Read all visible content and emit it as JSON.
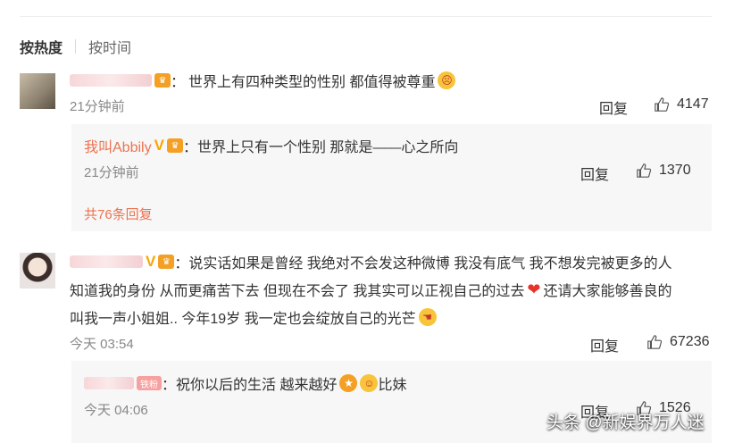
{
  "sort": {
    "hot": "按热度",
    "time": "按时间"
  },
  "comments": [
    {
      "text_prefix": "：",
      "text": "世界上有四种类型的性别 都值得被尊重",
      "time": "21分钟前",
      "reply_label": "回复",
      "likes": "4147",
      "replies": [
        {
          "username": "我叫Abbily",
          "text": "：世界上只有一个性别 那就是——心之所向",
          "time": "21分钟前",
          "reply_label": "回复",
          "likes": "1370"
        }
      ],
      "more_replies": "共76条回复"
    },
    {
      "text_line1": "：说实话如果是曾经 我绝对不会发这种微博 我没有底气 我不想发完被更多的人",
      "text_line2_a": "知道我的身份 从而更痛苦下去 但现在不会了 我其实可以正视自己的过去",
      "text_line2_b": "还请大家能够善良的",
      "text_line3": "叫我一声小姐姐.. 今年19岁 我一定也会绽放自己的光芒",
      "time": "今天 03:54",
      "reply_label": "回复",
      "likes": "67236",
      "replies": [
        {
          "badge": "铁粉",
          "text_a": "：祝你以后的生活 越来越好",
          "text_b": "比妹",
          "time": "今天 04:06",
          "reply_label": "回复",
          "likes": "1526"
        }
      ]
    }
  ],
  "watermark": "头条 @新娱界万人迷",
  "colors": {
    "accent": "#eb7350",
    "vip": "#f7a600",
    "heart": "#e8322c"
  },
  "icons": [
    "crown-badge-icon",
    "v-badge-icon",
    "surprised-emoji-icon",
    "heart-icon",
    "thumbs-up-icon",
    "hand-emoji-icon"
  ]
}
